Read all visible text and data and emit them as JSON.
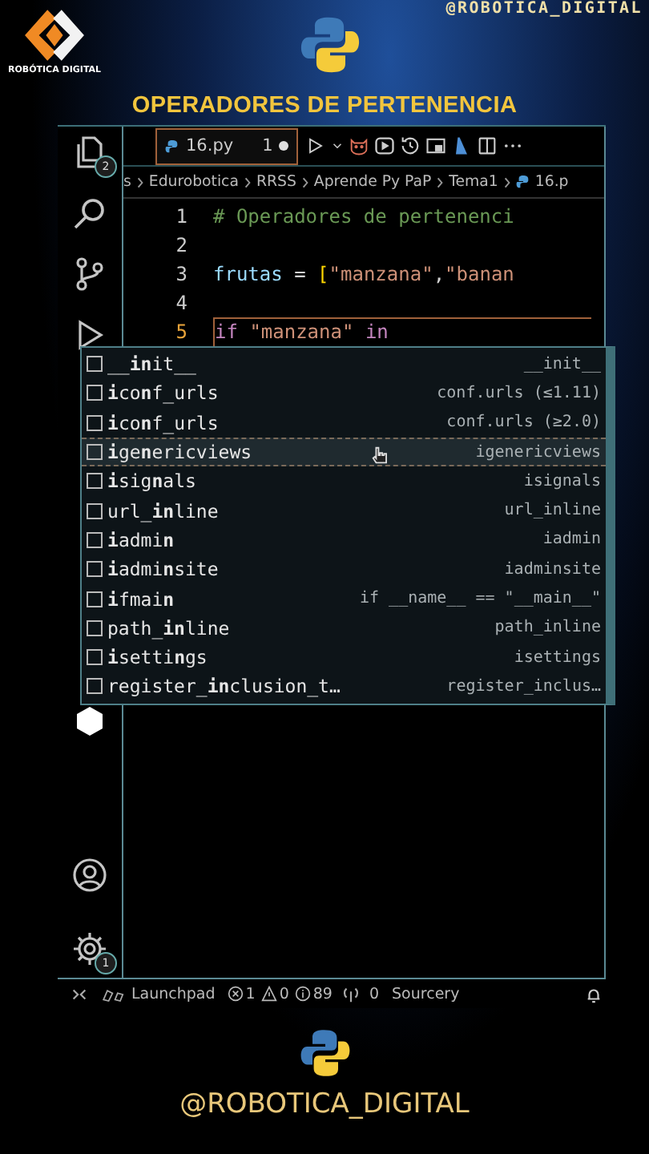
{
  "brand": {
    "logo_text": "ROBÓTICA DIGITAL",
    "handle": "@ROBOTICA_DIGITAL",
    "title": "OPERADORES DE PERTENENCIA"
  },
  "activity_top": [
    {
      "kind": "files",
      "badge": "2"
    },
    {
      "kind": "search"
    },
    {
      "kind": "branch"
    },
    {
      "kind": "run"
    }
  ],
  "activity_bottom": [
    {
      "kind": "hexagon"
    },
    {
      "kind": "account"
    },
    {
      "kind": "gear",
      "badge": "1"
    }
  ],
  "tab": {
    "name": "16.py",
    "problems": "1",
    "modified": true
  },
  "breadcrumb": [
    "s",
    "Edurobotica",
    "RRSS",
    "Aprende Py PaP",
    "Tema1",
    "16.p"
  ],
  "code": [
    {
      "number": "1",
      "current": false,
      "tokens": [
        {
          "text": "# Operadores de pertenenci",
          "kind": "comment"
        }
      ]
    },
    {
      "number": "2",
      "current": false
    },
    {
      "number": "3",
      "current": false,
      "tokens": [
        {
          "text": "frutas",
          "kind": "name"
        },
        {
          "text": " = ",
          "kind": "op"
        },
        {
          "text": "[",
          "kind": "bracket"
        },
        {
          "text": "\"manzana\"",
          "kind": "string"
        },
        {
          "text": ",",
          "kind": "op"
        },
        {
          "text": "\"banan",
          "kind": "string"
        }
      ]
    },
    {
      "number": "4",
      "current": false
    },
    {
      "number": "5",
      "current": true,
      "tokens": [
        {
          "text": "if ",
          "kind": "keyword"
        },
        {
          "text": "\"manzana\"",
          "kind": "string"
        },
        {
          "text": " in",
          "kind": "keyword"
        }
      ]
    }
  ],
  "suggestions": [
    {
      "label": "__**in**it__",
      "detail": "__init__",
      "selected": false
    },
    {
      "label": "**i**co**n**f_urls",
      "detail": "conf.urls (≤1.11)",
      "selected": false
    },
    {
      "label": "**i**co**n**f_urls",
      "detail": "conf.urls (≥2.0)",
      "selected": false
    },
    {
      "label": "**i**ge**n**ericviews",
      "detail": "igenericviews",
      "selected": true
    },
    {
      "label": "**i**sig**n**als",
      "detail": "isignals",
      "selected": false
    },
    {
      "label": "url_**in**line",
      "detail": "url_inline",
      "selected": false
    },
    {
      "label": "**i**admi**n**",
      "detail": "iadmin",
      "selected": false
    },
    {
      "label": "**i**admi**n**site",
      "detail": "iadminsite",
      "selected": false
    },
    {
      "label": "**i**fmai**n**",
      "detail": "if __name__ == \"__main__\"",
      "selected": false
    },
    {
      "label": "path_**in**line",
      "detail": "path_inline",
      "selected": false
    },
    {
      "label": "**i**setti**n**gs",
      "detail": "isettings",
      "selected": false
    },
    {
      "label": "register_**in**clusion_t…",
      "detail": "register_inclus…",
      "selected": false
    }
  ],
  "status_bar": [
    {
      "kind": "remote"
    },
    {
      "kind": "launchpad",
      "text": "Launchpad"
    },
    {
      "kind": "error",
      "text": "1"
    },
    {
      "kind": "warning",
      "text": "0"
    },
    {
      "kind": "info",
      "text": "89"
    },
    {
      "kind": "ports",
      "text": "0"
    },
    {
      "kind": "plain",
      "text": "Sourcery"
    },
    {
      "kind": "bell"
    }
  ],
  "footer": {
    "handle": "@ROBOTICA_DIGITAL"
  }
}
